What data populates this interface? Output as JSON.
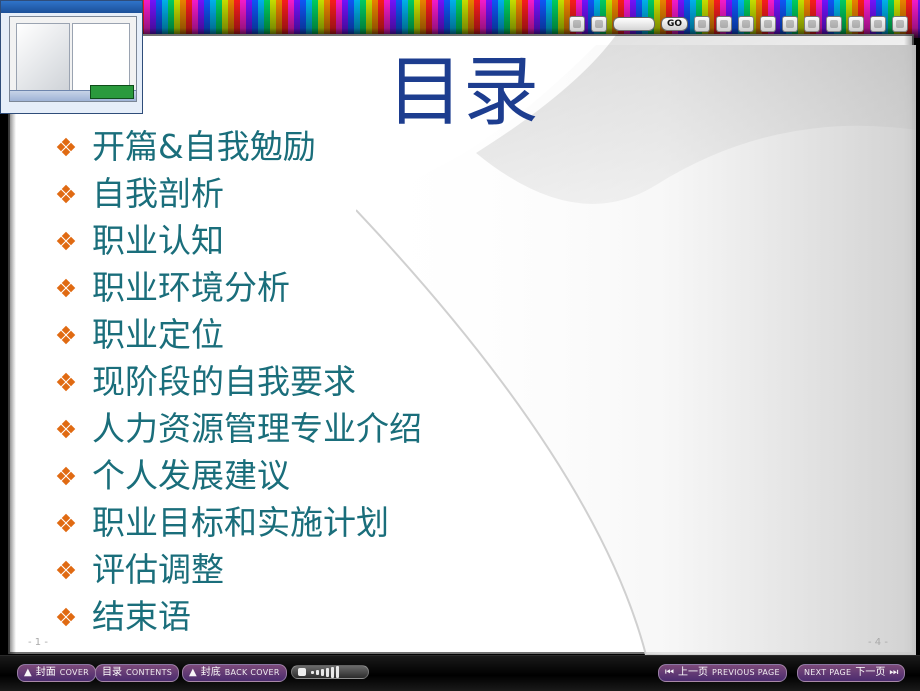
{
  "title": "目录",
  "toc_items": [
    "开篇&自我勉励",
    "自我剖析",
    "职业认知",
    "职业环境分析",
    "职业定位",
    "现阶段的自我要求",
    "人力资源管理专业介绍",
    "个人发展建议",
    "职业目标和实施计划",
    "评估调整",
    "结束语"
  ],
  "page_numbers": {
    "left": "- 1 -",
    "right": "- 4 -"
  },
  "toolbar": {
    "go_label": "GO"
  },
  "bottom_nav": {
    "cover": {
      "label_cn": "封面",
      "label_en": "COVER"
    },
    "contents": {
      "label_cn": "目录",
      "label_en": "CONTENTS"
    },
    "back_cover": {
      "label_cn": "封底",
      "label_en": "BACK COVER"
    },
    "prev": {
      "label_cn": "上一页",
      "label_en": "PREVIOUS PAGE"
    },
    "next": {
      "label_cn": "下一页",
      "label_en": "NEXT PAGE"
    }
  },
  "volume": {
    "level": 0.85
  },
  "colors": {
    "title": "#1d3d8f",
    "toc_text": "#1a6e7b",
    "bullet": "#e06a12",
    "page_bg": "#ffffff"
  },
  "icons": {
    "search": "search-icon",
    "settings": "gear-icon",
    "minimize": "minimize-icon",
    "maximize": "maximize-icon",
    "close": "close-icon"
  }
}
